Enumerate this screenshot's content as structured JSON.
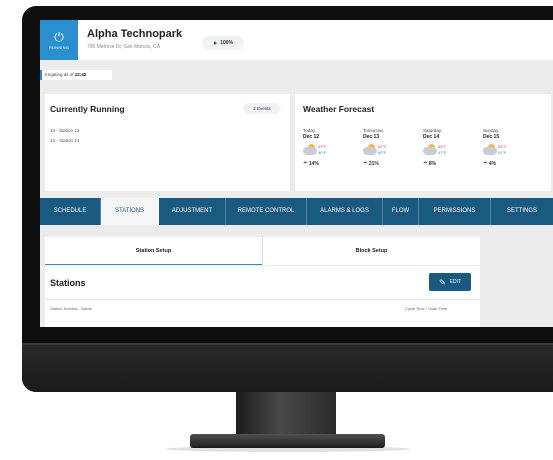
{
  "power": {
    "label": "RUNNING"
  },
  "site": {
    "name": "Alpha Technopark",
    "address": "795 Melrose Dr, San Marcos, CA",
    "water_budget": "100%"
  },
  "status": {
    "prefix": "Irrigating as of",
    "time": "12:42"
  },
  "running": {
    "title": "Currently Running",
    "events_badge": "2 Events",
    "stations": [
      "13 - Station 13",
      "14 - Station 14"
    ]
  },
  "weather": {
    "title": "Weather Forecast",
    "days": [
      {
        "day": "Today,",
        "date": "Dec 12",
        "high": "63°F",
        "low": "50°F",
        "rain": "14%"
      },
      {
        "day": "Tomorrow,",
        "date": "Dec 13",
        "high": "62°F",
        "low": "50°F",
        "rain": "21%"
      },
      {
        "day": "Saturday,",
        "date": "Dec 14",
        "high": "65°F",
        "low": "47°F",
        "rain": "8%"
      },
      {
        "day": "Sunday,",
        "date": "Dec 15",
        "high": "63°F",
        "low": "51°F",
        "rain": "4%"
      }
    ]
  },
  "tabs": [
    "SCHEDULE",
    "STATIONS",
    "ADJUSTMENT",
    "REMOTE CONTROL",
    "ALARMS & LOGS",
    "FLOW",
    "PERMISSIONS",
    "SETTINGS"
  ],
  "subtabs": [
    "Station Setup",
    "Block Setup"
  ],
  "stations_panel": {
    "title": "Stations",
    "edit_label": "EDIT",
    "col_left": "Station Number - Name",
    "col_right": "Cycle Time / Soak Time"
  },
  "colors": {
    "accent": "#2a8fd0",
    "nav": "#1a5a80"
  },
  "icons": [
    "power-icon",
    "water-drop-icon",
    "pencil-icon",
    "cloud-sun-icon",
    "rain-icon"
  ]
}
